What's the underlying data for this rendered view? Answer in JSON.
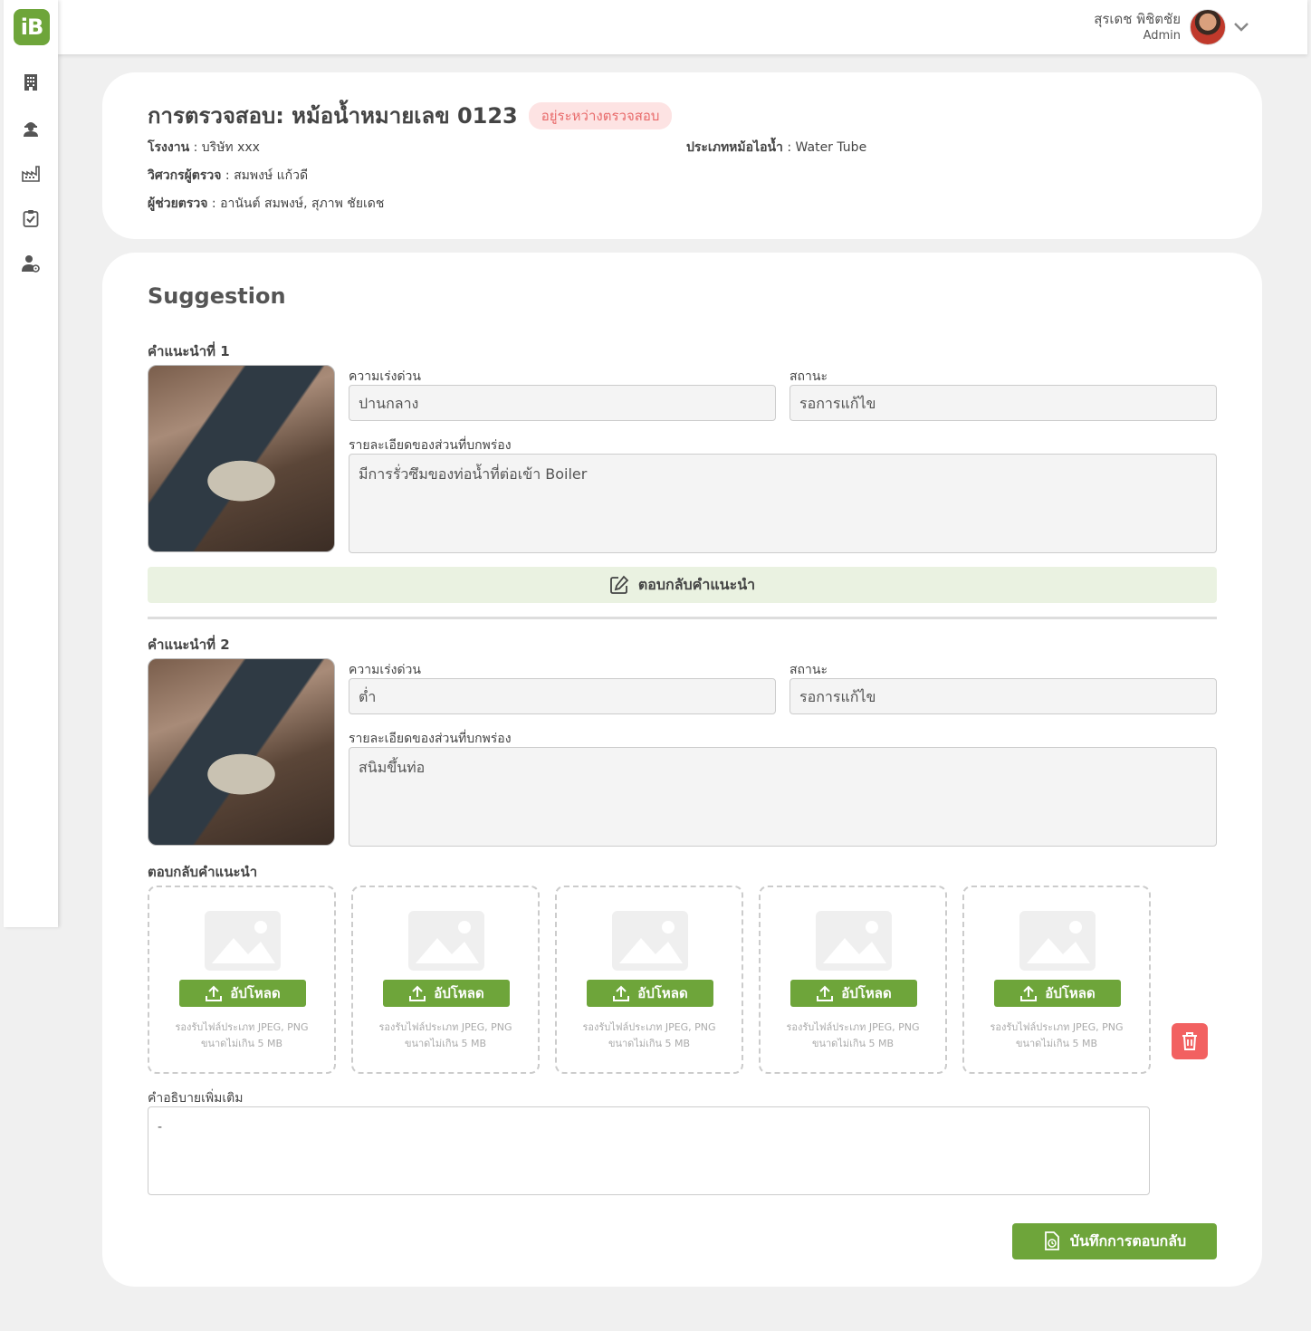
{
  "app": {
    "logo_text": "iB"
  },
  "sidebar": {
    "items": [
      {
        "icon": "building-icon"
      },
      {
        "icon": "engineer-icon"
      },
      {
        "icon": "factory-icon"
      },
      {
        "icon": "clipboard-check-icon"
      },
      {
        "icon": "user-settings-icon"
      }
    ]
  },
  "user": {
    "name": "สุรเดช พิชิตชัย",
    "role": "Admin"
  },
  "inspection": {
    "title": "การตรวจสอบ: หม้อน้ำหมายเลข 0123",
    "status": "อยู่ระหว่างตรวจสอบ",
    "factory_label": "โรงงาน",
    "factory_value": "บริษัท xxx",
    "boiler_type_label": "ประเภทหม้อไอน้ำ",
    "boiler_type_value": "Water Tube",
    "engineer_label": "วิศวกรผู้ตรวจ",
    "engineer_value": "สมพงษ์ แก้วดี",
    "assistants_label": "ผู้ช่วยตรวจ",
    "assistants_value": "อานันต์ สมพงษ์, สุภาพ ชัยเดช"
  },
  "suggestion": {
    "section_title": "Suggestion",
    "urgency_label": "ความเร่งด่วน",
    "status_label": "สถานะ",
    "detail_label": "รายละเอียดของส่วนที่บกพร่อง",
    "items": [
      {
        "label": "คำแนะนำที่ 1",
        "urgency": "ปานกลาง",
        "status": "รอการแก้ไข",
        "detail": "มีการรั่วซึมของท่อน้ำที่ต่อเข้า Boiler"
      },
      {
        "label": "คำแนะนำที่ 2",
        "urgency": "ต่ำ",
        "status": "รอการแก้ไข",
        "detail": "สนิมขึ้นท่อ"
      }
    ],
    "reply_button": "ตอบกลับคำแนะนำ",
    "reply_section_label": "ตอบกลับคำแนะนำ",
    "upload_label": "อัปโหลด",
    "upload_hint_1": "รองรับไฟล์ประเภท JPEG, PNG",
    "upload_hint_2": "ขนาดไม่เกิน 5 MB",
    "more_label": "คำอธิบายเพิ่มเติม",
    "more_value": "-",
    "save_button": "บันทึกการตอบกลับ"
  },
  "colors": {
    "brand": "#6ea53a",
    "danger": "#f26161",
    "badge_bg": "#fde3e3",
    "badge_text": "#e86a6a"
  }
}
